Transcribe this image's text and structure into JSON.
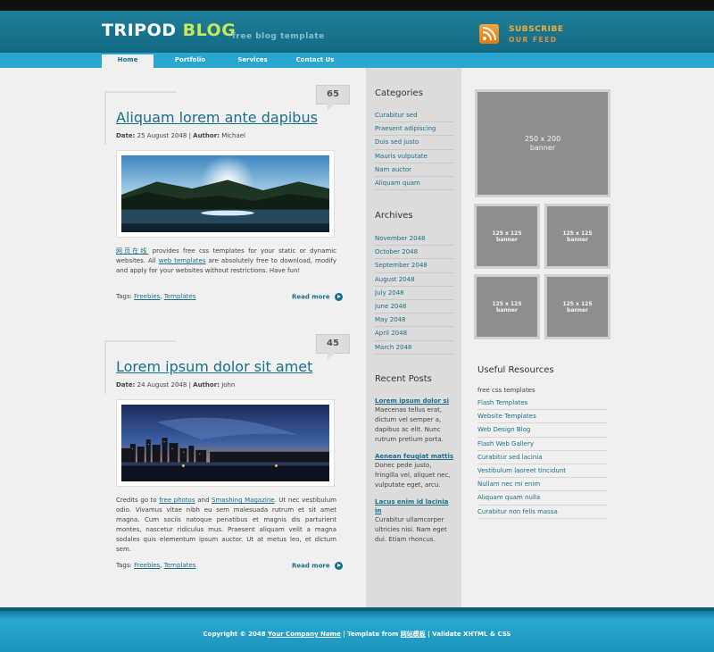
{
  "header": {
    "logo_main": "TRIPOD ",
    "logo_accent": "BLOG",
    "tagline": "free blog template",
    "subscribe_line1": "SUBSCRIBE",
    "subscribe_line2": "OUR FEED",
    "icon": "rss-icon"
  },
  "nav": {
    "items": [
      "Home",
      "Portfolio",
      "Services",
      "Contact Us"
    ],
    "active": "Home"
  },
  "posts": [
    {
      "comments": "65",
      "title": "Aliquam lorem ante dapibus",
      "date_label": "Date:",
      "date": "25 August 2048",
      "author_label": "Author:",
      "author": "Michael",
      "text_link1": "网页在线",
      "text_part1": " provides free css templates for your static or dynamic websites. All ",
      "text_link2": "web templates",
      "text_part2": " are absolutely free to download, modify and apply for your websites without restrictions. Have fun!",
      "tags_label": "Tags:",
      "tag1": "Freebies",
      "tag2": "Templates",
      "read_more": "Read more"
    },
    {
      "comments": "45",
      "title": "Lorem ipsum dolor sit amet",
      "date_label": "Date:",
      "date": "24 August 2048",
      "author_label": "Author:",
      "author": "John",
      "text_part0": "Credits go to ",
      "text_link1": "free photos",
      "text_and": " and ",
      "text_link2": "Smashing Magazine",
      "text_part2": ". Ut nec vestibulum odio. Vivamus vitae nibh eu sem malesuada rutrum et sit amet magna. Cum sociis natoque penatibus et magnis dis parturient montes, nascetur ridiculus mus. Praesent aliquam velit a magna sodales quis elementum ipsum auctor. Ut at metus leo, et dictum sem.",
      "tags_label": "Tags:",
      "tag1": "Freebies",
      "tag2": "Templates",
      "read_more": "Read more"
    }
  ],
  "sidebar": {
    "categories_title": "Categories",
    "categories": [
      "Curabitur sed",
      "Praesent adipiscing",
      "Duis sed justo",
      "Mauris vulputate",
      "Nam auctor",
      "Aliquam quam"
    ],
    "archives_title": "Archives",
    "archives": [
      "November 2048",
      "October 2048",
      "September 2048",
      "August 2048",
      "July 2048",
      "June 2048",
      "May 2048",
      "April 2048",
      "March 2048"
    ],
    "recent_title": "Recent Posts",
    "recent": [
      {
        "title": "Lorem ipsum dolor si",
        "text": "Maecenas tellus erat, dictum vel semper a, dapibus ac elit. Nunc rutrum pretium porta."
      },
      {
        "title": "Aenean feugiat mattis",
        "text": "Donec pede justo, fringilla vel, aliquet nec, vulputate eget, arcu."
      },
      {
        "title": "Lacus enim id lacinia in",
        "text": "Curabitur ullamcorper ultricies nisi. Nam eget dui. Etiam rhoncus."
      }
    ]
  },
  "banners": {
    "big": "250 x 200\nbanner",
    "small": [
      "125 x 125\nbanner",
      "125 x 125\nbanner",
      "125 x 125\nbanner",
      "125 x 125\nbanner"
    ]
  },
  "resources": {
    "title": "Useful Resources",
    "intro": "free css templates",
    "links": [
      "Flash Templates",
      "Website Templates",
      "Web Design Blog",
      "Flash Web Gallery",
      "Curabitur sed lacinia",
      "Vestibulum laoreet tincidunt",
      "Nullam nec mi enim",
      "Aliquam quam nulla",
      "Curabitur non felis massa"
    ]
  },
  "footer": {
    "copyright": "Copyright © 2048 ",
    "company": "Your Company Name",
    "template_from": " | Template from ",
    "template_link": "网站模板",
    "validate": " | Validate XHTML & CSS"
  },
  "colors": {
    "header": "#1a7891",
    "nav": "#2aa7d0",
    "link": "#1a6f8a",
    "accent": "#c8e85a",
    "rss": "#f2a93b"
  }
}
